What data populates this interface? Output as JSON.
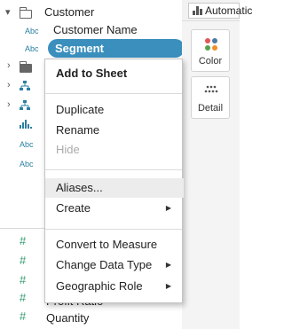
{
  "data_pane": {
    "dimensions_folder": "Customer",
    "customer_name": "Customer Name",
    "segment": "Segment",
    "icons": {
      "abc": "Abc",
      "hash": "#"
    },
    "bottom_partial": "Profit Ratio",
    "quantity": "Quantity"
  },
  "marks": {
    "auto_label": "Automatic",
    "color_label": "Color",
    "detail_label": "Detail"
  },
  "context_menu": {
    "items": [
      {
        "label": "Add to Sheet"
      },
      {
        "label": "Duplicate"
      },
      {
        "label": "Rename"
      },
      {
        "label": "Hide"
      },
      {
        "label": "Aliases..."
      },
      {
        "label": "Create"
      },
      {
        "label": "Convert to Measure"
      },
      {
        "label": "Change Data Type"
      },
      {
        "label": "Geographic Role"
      }
    ]
  },
  "colors": {
    "pill": "#3a8fbd",
    "field_icon": "#2a7fa3",
    "measure_icon": "#2f9a6b"
  }
}
